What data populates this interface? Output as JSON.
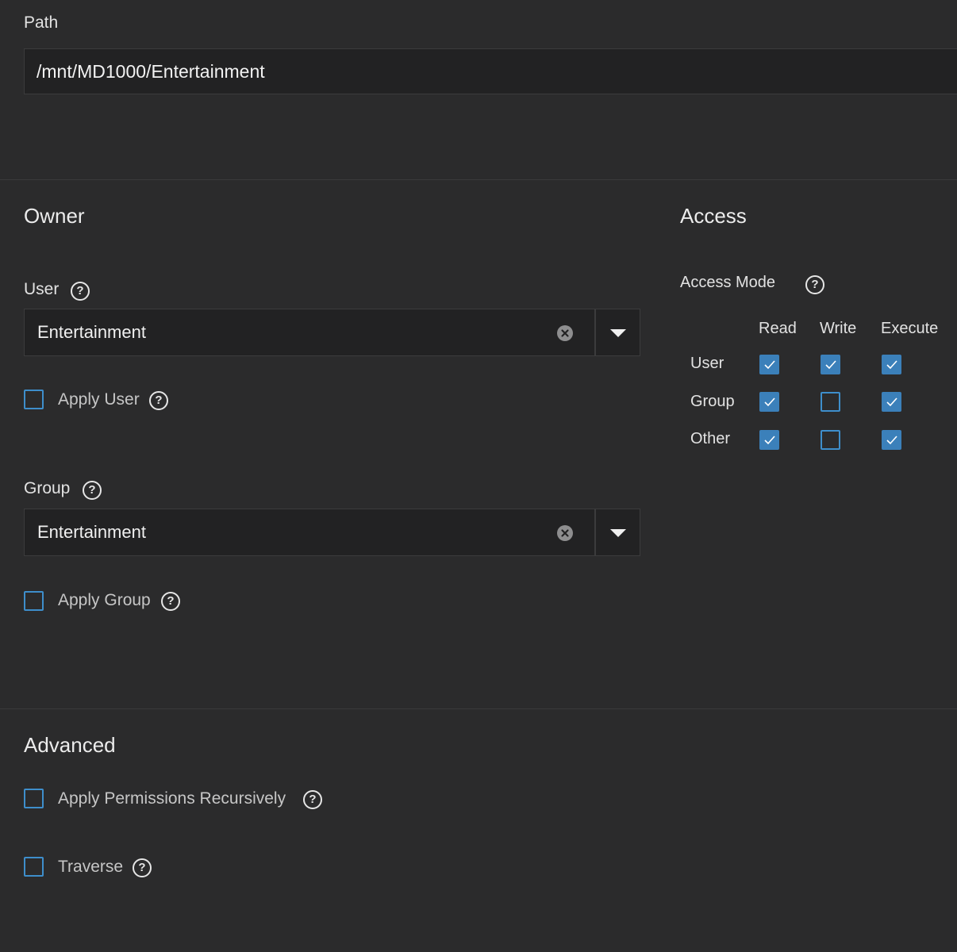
{
  "path": {
    "label": "Path",
    "value": "/mnt/MD1000/Entertainment"
  },
  "owner": {
    "title": "Owner",
    "user": {
      "label": "User",
      "value": "Entertainment",
      "apply_label": "Apply User",
      "apply_checked": false
    },
    "group": {
      "label": "Group",
      "value": "Entertainment",
      "apply_label": "Apply Group",
      "apply_checked": false
    }
  },
  "access": {
    "title": "Access",
    "mode_label": "Access Mode",
    "columns": [
      "Read",
      "Write",
      "Execute"
    ],
    "rows": [
      {
        "label": "User",
        "read": true,
        "write": true,
        "execute": true
      },
      {
        "label": "Group",
        "read": true,
        "write": false,
        "execute": true
      },
      {
        "label": "Other",
        "read": true,
        "write": false,
        "execute": true
      }
    ]
  },
  "advanced": {
    "title": "Advanced",
    "recursive_label": "Apply Permissions Recursively",
    "recursive_checked": false,
    "traverse_label": "Traverse",
    "traverse_checked": false
  },
  "help_glyph": "?",
  "colors": {
    "background": "#2b2b2c",
    "input_bg": "#222223",
    "accent": "#3b80ba"
  }
}
